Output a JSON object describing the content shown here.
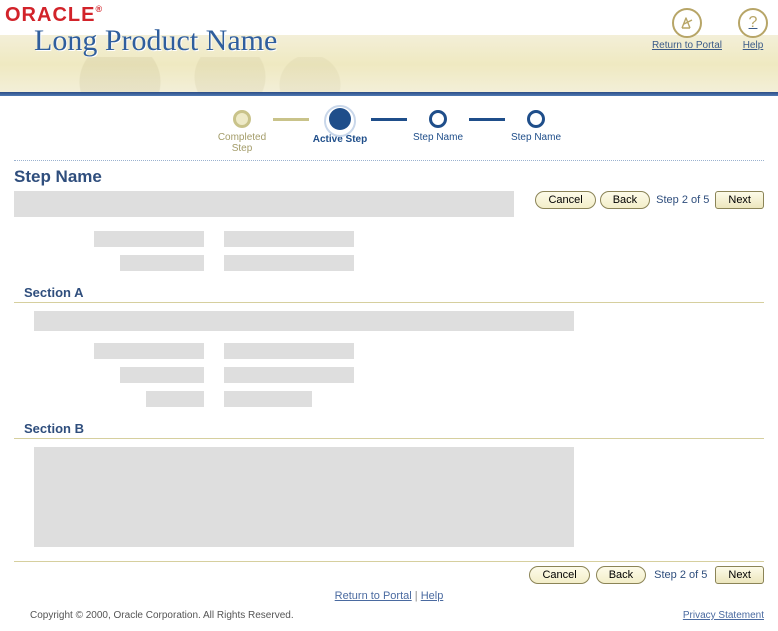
{
  "brand": {
    "logo": "ORACLE",
    "logo_sup": "®",
    "product": "Long Product Name"
  },
  "global": {
    "return_label": "Return to Portal",
    "help_label": "Help"
  },
  "wizard": {
    "steps": [
      {
        "label": "Completed Step",
        "state": "completed"
      },
      {
        "label": "Active Step",
        "state": "active"
      },
      {
        "label": "Step Name",
        "state": "pending"
      },
      {
        "label": "Step Name",
        "state": "pending"
      }
    ],
    "page_title": "Step Name",
    "section_a": "Section A",
    "section_b": "Section B",
    "cancel": "Cancel",
    "back": "Back",
    "next": "Next",
    "indicator": "Step 2 of 5"
  },
  "footer": {
    "return_link": "Return to Portal",
    "help_link": "Help",
    "separator": "  |  ",
    "copyright": "Copyright © 2000, Oracle Corporation. All Rights Reserved.",
    "privacy": "Privacy Statement"
  }
}
